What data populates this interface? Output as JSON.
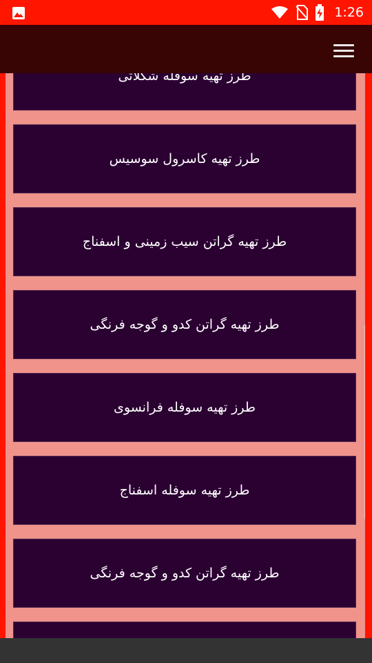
{
  "status_bar": {
    "time": "1:26",
    "icons": [
      "image-icon",
      "wifi-icon",
      "no-sim-icon",
      "battery-charging-icon"
    ],
    "background": "#ff1500"
  },
  "app_bar": {
    "menu_icon": "hamburger-menu-icon",
    "background": "#380404"
  },
  "list": {
    "items": [
      {
        "label": "طرز تهیه سوفله شکلاتی"
      },
      {
        "label": "طرز تهیه کاسرول سوسیس"
      },
      {
        "label": "طرز تهیه گراتن سیب زمینی و اسفناج"
      },
      {
        "label": "طرز تهیه گراتن کدو و گوجه فرنگی"
      },
      {
        "label": "طرز تهیه سوفله فرانسوی"
      },
      {
        "label": "طرز تهیه سوفله اسفناج"
      },
      {
        "label": "طرز تهیه گراتن کدو و گوجه فرنگی"
      },
      {
        "label": ""
      }
    ],
    "item_color": "#2b0132",
    "background": "#ef938b"
  }
}
